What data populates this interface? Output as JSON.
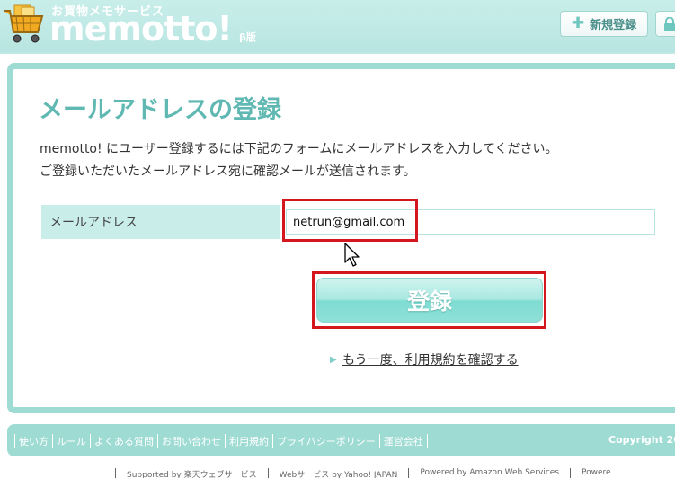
{
  "header": {
    "tagline": "お買物メモサービス",
    "logo": "memotto!",
    "beta": "β版",
    "register_button": "新規登録"
  },
  "main": {
    "title": "メールアドレスの登録",
    "intro_line1": "memotto! にユーザー登録するには下記のフォームにメールアドレスを入力してください。",
    "intro_line2": "ご登録いただいたメールアドレス宛に確認メールが送信されます。",
    "email_label": "メールアドレス",
    "email_value": "netrun@gmail.com",
    "submit_button": "登録",
    "terms_link": "もう一度、利用規約を確認する"
  },
  "footer": {
    "links": [
      "使い方",
      "ルール",
      "よくある質問",
      "お問い合わせ",
      "利用規約",
      "プライバシーポリシー",
      "運営会社"
    ],
    "copyright": "Copyright 20",
    "credits": [
      "Supported by 楽天ウェブサービス",
      "Webサービス by Yahoo! JAPAN",
      "Powered by Amazon Web Services",
      "Powere"
    ]
  },
  "colors": {
    "accent": "#9edbd3",
    "title": "#5fb8b2",
    "highlight": "#d4161f"
  }
}
